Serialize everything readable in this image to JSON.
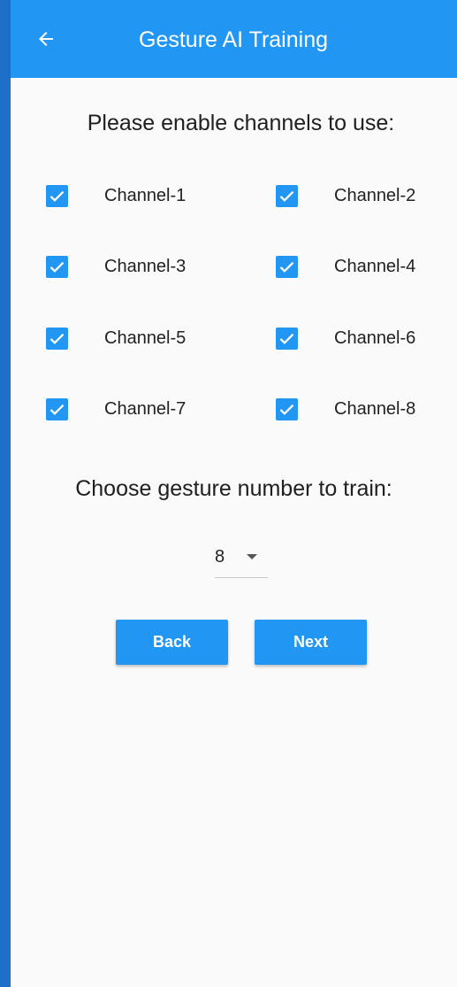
{
  "appbar": {
    "title": "Gesture AI Training",
    "back_icon": "arrow-left-icon"
  },
  "prompt_channels": "Please enable channels to use:",
  "channels": [
    {
      "label": "Channel-1",
      "checked": true
    },
    {
      "label": "Channel-2",
      "checked": true
    },
    {
      "label": "Channel-3",
      "checked": true
    },
    {
      "label": "Channel-4",
      "checked": true
    },
    {
      "label": "Channel-5",
      "checked": true
    },
    {
      "label": "Channel-6",
      "checked": true
    },
    {
      "label": "Channel-7",
      "checked": true
    },
    {
      "label": "Channel-8",
      "checked": true
    }
  ],
  "prompt_gesture": "Choose gesture number to train:",
  "gesture_select": {
    "value": "8"
  },
  "buttons": {
    "back": "Back",
    "next": "Next"
  },
  "colors": {
    "primary": "#2196f3",
    "background": "#fafafa",
    "frame": "#1e6fc8"
  }
}
